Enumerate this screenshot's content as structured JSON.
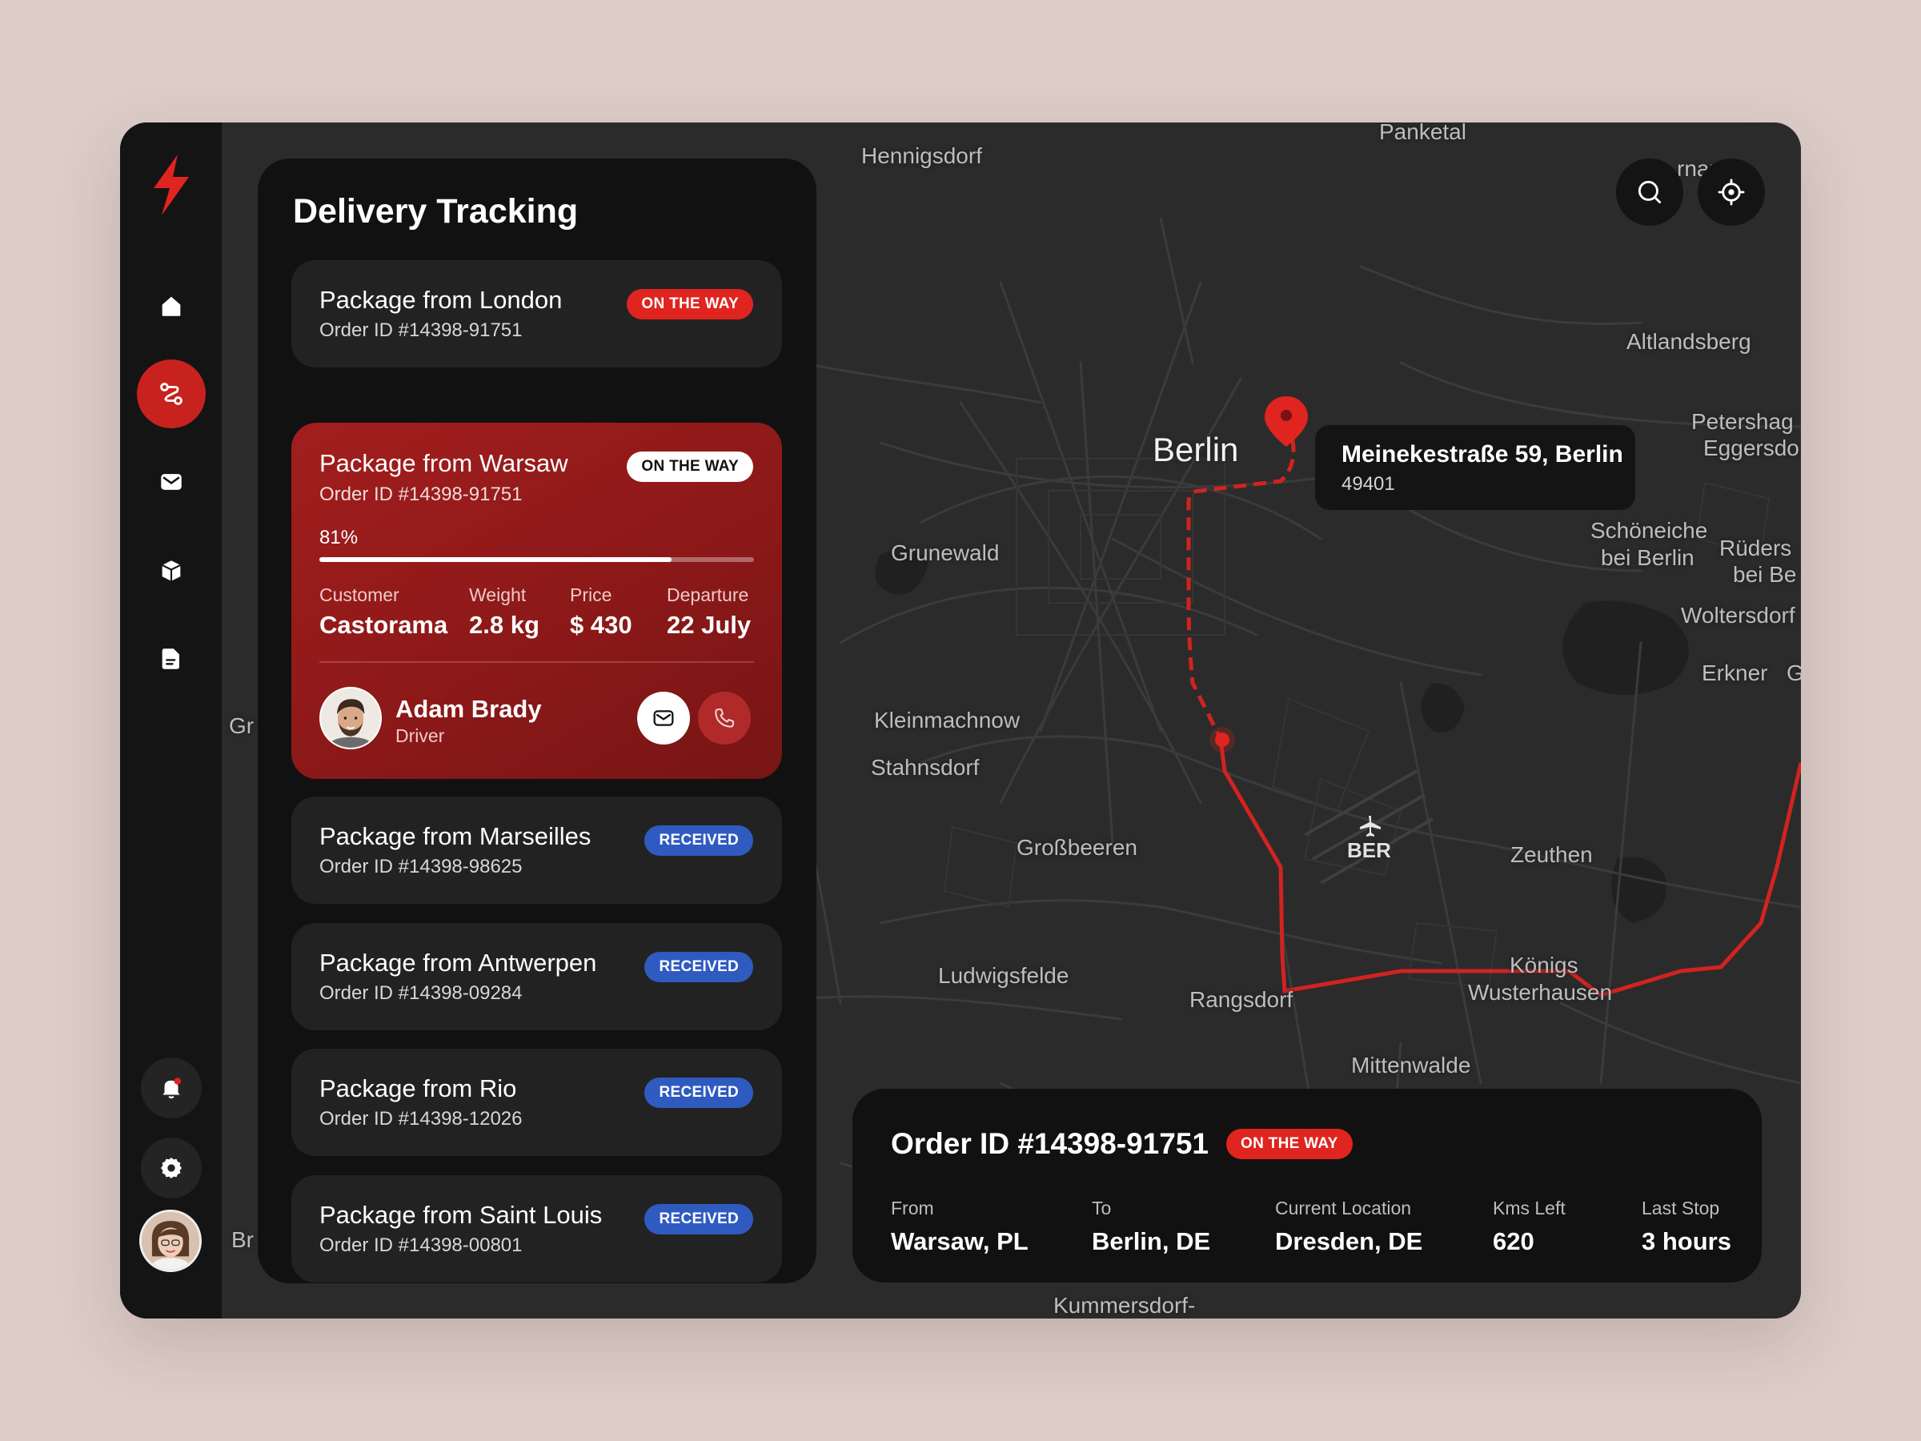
{
  "panel": {
    "title": "Delivery Tracking"
  },
  "packages": [
    {
      "name": "Package from London",
      "order_id": "Order ID #14398-91751",
      "status": "ON THE WAY"
    },
    {
      "name": "Package from Warsaw",
      "order_id": "Order ID #14398-91751",
      "status": "ON THE WAY"
    },
    {
      "name": "Package from Marseilles",
      "order_id": "Order ID #14398-98625",
      "status": "RECEIVED"
    },
    {
      "name": "Package from Antwerpen",
      "order_id": "Order ID #14398-09284",
      "status": "RECEIVED"
    },
    {
      "name": "Package from Rio",
      "order_id": "Order ID #14398-12026",
      "status": "RECEIVED"
    },
    {
      "name": "Package from Saint Louis",
      "order_id": "Order ID #14398-00801",
      "status": "RECEIVED"
    }
  ],
  "active": {
    "progress_label": "81%",
    "progress": 0.81,
    "customer_label": "Customer",
    "customer": "Castorama",
    "weight_label": "Weight",
    "weight": "2.8 kg",
    "price_label": "Price",
    "price": "$ 430",
    "departure_label": "Departure",
    "departure": "22 July",
    "driver_name": "Adam Brady",
    "driver_role": "Driver"
  },
  "map": {
    "labels": {
      "panketal": "Panketal",
      "hennigsdorf": "Hennigsdorf",
      "altlandsberg": "Altlandsberg",
      "petershagen": "Petershag",
      "eggersdorf": "Eggersdo",
      "berlin": "Berlin",
      "grunewald": "Grunewald",
      "schoeneiche1": "Schöneiche",
      "schoeneiche2": "bei Berlin",
      "rueders1": "Rüders",
      "rueders2": "bei Be",
      "woltersdorf": "Woltersdorf",
      "erkner": "Erkner",
      "erkner_g": "G",
      "kleinmachnow": "Kleinmachnow",
      "stahnsdorf": "Stahnsdorf",
      "grossbeeren": "Großbeeren",
      "ber": "BER",
      "zeuthen": "Zeuthen",
      "ludwigsfelde": "Ludwigsfelde",
      "rangsdorf": "Rangsdorf",
      "koenigs1": "Königs",
      "koenigs2": "Wusterhausen",
      "mittenwalde": "Mittenwalde",
      "kummersdorf": "Kummersdorf-",
      "gr": "Gr",
      "br": "Br",
      "bernau_partial": "rnau  on"
    },
    "destination": {
      "address": "Meinekestraße 59, Berlin",
      "zip": "49401"
    }
  },
  "order": {
    "title": "Order ID #14398-91751",
    "status": "ON THE WAY",
    "from_label": "From",
    "from": "Warsaw, PL",
    "to_label": "To",
    "to": "Berlin, DE",
    "current_label": "Current Location",
    "current": "Dresden, DE",
    "kms_label": "Kms Left",
    "kms": "620",
    "last_label": "Last Stop",
    "last": "3 hours"
  },
  "colors": {
    "accent": "#e0241f",
    "received": "#2f5bc0",
    "panel": "#111111",
    "sidebar": "#141414"
  }
}
